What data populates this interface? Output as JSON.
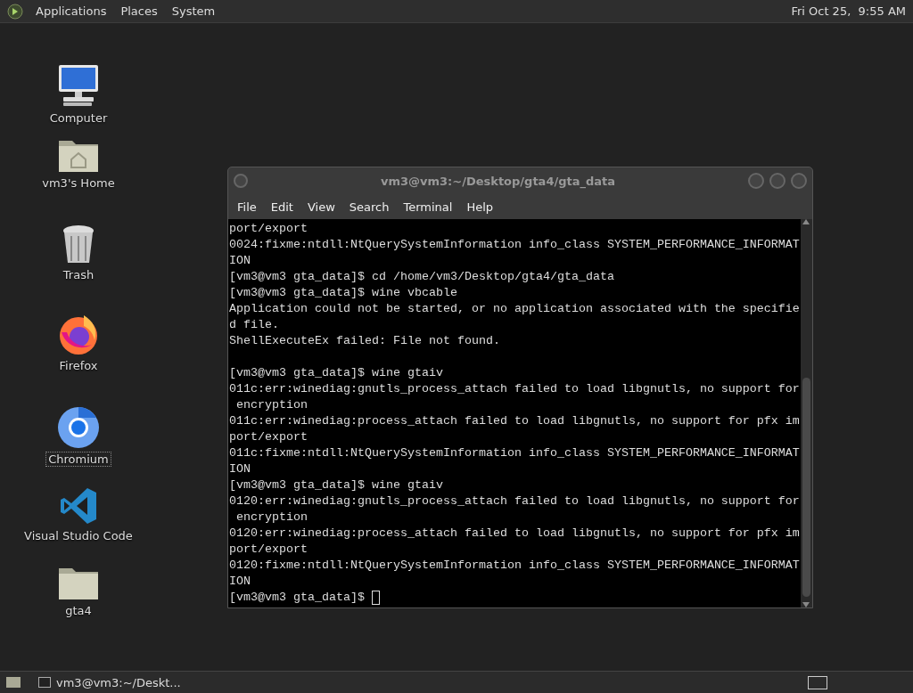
{
  "top_panel": {
    "menus": [
      "Applications",
      "Places",
      "System"
    ],
    "clock": "Fri Oct 25,  9:55 AM"
  },
  "desktop_icons": [
    {
      "kind": "computer",
      "label": "Computer",
      "selected": false
    },
    {
      "kind": "home",
      "label": "vm3's Home",
      "selected": false
    },
    {
      "kind": "trash",
      "label": "Trash",
      "selected": false
    },
    {
      "kind": "firefox",
      "label": "Firefox",
      "selected": false
    },
    {
      "kind": "chromium",
      "label": "Chromium",
      "selected": true
    },
    {
      "kind": "vscode",
      "label": "Visual Studio Code",
      "selected": false
    },
    {
      "kind": "folder",
      "label": "gta4",
      "selected": false
    }
  ],
  "terminal": {
    "title": "vm3@vm3:~/Desktop/gta4/gta_data",
    "menu": [
      "File",
      "Edit",
      "View",
      "Search",
      "Terminal",
      "Help"
    ],
    "lines": [
      {
        "kind": "output",
        "text": "port/export"
      },
      {
        "kind": "output",
        "text": "0024:fixme:ntdll:NtQuerySystemInformation info_class SYSTEM_PERFORMANCE_INFORMAT"
      },
      {
        "kind": "output",
        "text": "ION"
      },
      {
        "kind": "output",
        "text": "[vm3@vm3 gta_data]$ cd /home/vm3/Desktop/gta4/gta_data"
      },
      {
        "kind": "output",
        "text": "[vm3@vm3 gta_data]$ wine vbcable"
      },
      {
        "kind": "output",
        "text": "Application could not be started, or no application associated with the specifie"
      },
      {
        "kind": "output",
        "text": "d file."
      },
      {
        "kind": "output",
        "text": "ShellExecuteEx failed: File not found."
      },
      {
        "kind": "blank"
      },
      {
        "kind": "output",
        "text": "[vm3@vm3 gta_data]$ wine gtaiv"
      },
      {
        "kind": "output",
        "text": "011c:err:winediag:gnutls_process_attach failed to load libgnutls, no support for"
      },
      {
        "kind": "output",
        "text": " encryption"
      },
      {
        "kind": "output",
        "text": "011c:err:winediag:process_attach failed to load libgnutls, no support for pfx im"
      },
      {
        "kind": "output",
        "text": "port/export"
      },
      {
        "kind": "output",
        "text": "011c:fixme:ntdll:NtQuerySystemInformation info_class SYSTEM_PERFORMANCE_INFORMAT"
      },
      {
        "kind": "output",
        "text": "ION"
      },
      {
        "kind": "output",
        "text": "[vm3@vm3 gta_data]$ wine gtaiv"
      },
      {
        "kind": "output",
        "text": "0120:err:winediag:gnutls_process_attach failed to load libgnutls, no support for"
      },
      {
        "kind": "output",
        "text": " encryption"
      },
      {
        "kind": "output",
        "text": "0120:err:winediag:process_attach failed to load libgnutls, no support for pfx im"
      },
      {
        "kind": "output",
        "text": "port/export"
      },
      {
        "kind": "output",
        "text": "0120:fixme:ntdll:NtQuerySystemInformation info_class SYSTEM_PERFORMANCE_INFORMAT"
      },
      {
        "kind": "output",
        "text": "ION"
      },
      {
        "kind": "prompt",
        "text": "[vm3@vm3 gta_data]$"
      }
    ]
  },
  "taskbar": {
    "tasks": [
      {
        "label": "vm3@vm3:~/Deskt...",
        "selected": false
      }
    ]
  }
}
